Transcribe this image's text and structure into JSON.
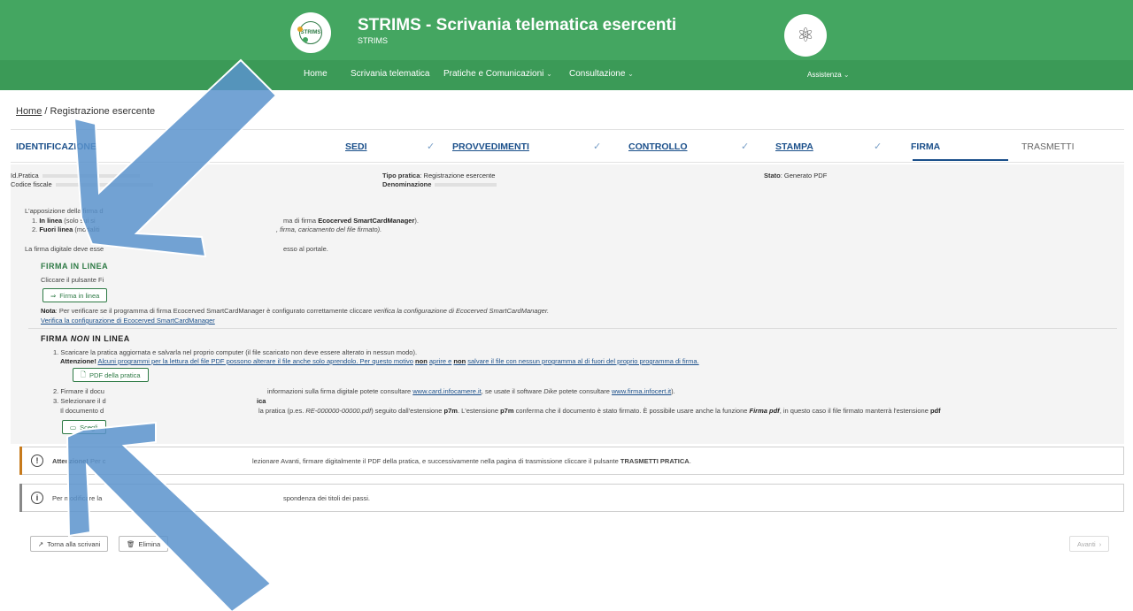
{
  "header": {
    "logo_text": "STRIMS",
    "title": "STRIMS - Scrivania telematica esercenti",
    "subtitle": "STRIMS"
  },
  "nav": {
    "home": "Home",
    "scrivania": "Scrivania telematica",
    "pratiche": "Pratiche e Comunicazioni",
    "consultazione": "Consultazione",
    "assistenza": "Assistenza"
  },
  "breadcrumb": {
    "home": "Home",
    "sep": "/",
    "current": "Registrazione esercente"
  },
  "steps": {
    "identificazione": "IDENTIFICAZIONE",
    "sedi": "SEDI",
    "provvedimenti": "PROVVEDIMENTI",
    "controllo": "CONTROLLO",
    "stampa": "STAMPA",
    "firma": "FIRMA",
    "trasmetti": "TRASMETTI",
    "check": "✓"
  },
  "info": {
    "id_pratica_label": "Id.Pratica",
    "codice_fiscale_label": "Codice fiscale",
    "tipo_pratica_label": "Tipo pratica",
    "tipo_pratica_value": "Registrazione esercente",
    "denominazione_label": "Denominazione",
    "stato_label": "Stato",
    "stato_value": "Generato PDF"
  },
  "firma": {
    "intro": "L'apposizione della firma d",
    "item1_bold": "In linea",
    "item1_text": "(solo sui si",
    "item1_tail": "ma di firma",
    "item1_tail_bold": "Ecocerved SmartCardManager",
    "item1_end": ").",
    "item2_bold": "Fuori linea",
    "item2_text": "(modaliti",
    "item2_tail": ", firma, caricamento del file firmato).",
    "note_start": "La firma digitale deve esse",
    "note_end": "esso al portale.",
    "online_title": "FIRMA IN LINEA",
    "online_hint": "Cliccare il pulsante Fi",
    "online_button": "Firma in linea",
    "nota_label": "Nota",
    "nota_text": ": Per verificare se il programma di firma Ecocerved SmartCardManager è configurato correttamente cliccare",
    "nota_italic": "verifica la configurazione di Ecocerved SmartCardManager.",
    "verify_link": "Verifica la configurazione di Ecocerved SmartCardManager",
    "offline_title_a": "FIRMA",
    "offline_title_b": "NON",
    "offline_title_c": "IN LINEA",
    "step1": "1. Scaricare la pratica aggiornata e salvarla nel proprio computer (il file scaricato non deve essere alterato in nessun modo).",
    "attenzione_label": "Attenzione!",
    "attenzione_text": "Alcuni programmi per la lettura del file PDF possono alterare il file anche solo aprendolo. Per questo motivo",
    "non": "non",
    "attenzione_text2": "aprire e",
    "attenzione_text3": "salvare il file con nessun programma al di fuori del proprio programma di firma.",
    "pdf_button": "PDF della pratica",
    "step2_start": "2. Firmare il docu",
    "step2_mid": "informazioni sulla firma digitale potete consultare",
    "step2_link1": "www.card.infocamere.it",
    "step2_mid2": ", se usate il software",
    "step2_dike": "Dike",
    "step2_mid3": "potete consultare",
    "step2_link2": "www.firma.infocert.it",
    "step2_end": ").",
    "step3_start": "3. Selezionare il d",
    "step3_bold": "ica",
    "step3_detail_start": "Il documento d",
    "step3_detail_mid": "la pratica (p.es.",
    "step3_example": "RE-000000-00000.pdf",
    "step3_detail2": ") seguito dall'estensione",
    "p7m": "p7m",
    "step3_detail3": ". L'estensione",
    "step3_detail4": "conferma che il documento è stato firmato. È possibile usare anche la funzione",
    "firma_pdf": "Firma pdf",
    "step3_detail5": ", in questo caso il file firmato manterrà l'estensione",
    "pdf": "pdf",
    "choose_button": "Scegli"
  },
  "alerts": {
    "warning_bold": "Attenzione!",
    "warning_text_a": "Per c",
    "warning_text_b": "lezionare Avanti, firmare digitalmente il PDF della pratica, e successivamente nella pagina di trasmissione cliccare il pulsante",
    "warning_text_bold": "TRASMETTI PRATICA",
    "warning_end": ".",
    "info_text_a": "Per modificare la",
    "info_text_b": "spondenza dei titoli dei passi."
  },
  "footer": {
    "back_button": "Torna alla scrivani",
    "delete_button": "Elimina",
    "next_button": "Avanti"
  },
  "colors": {
    "header_green": "#44a661",
    "nav_green": "#3b9a57",
    "accent_blue": "#1a4f8a",
    "warning_edge": "#c77a1c",
    "info_edge": "#888888",
    "overlay_arrow": "#5b93cc"
  }
}
